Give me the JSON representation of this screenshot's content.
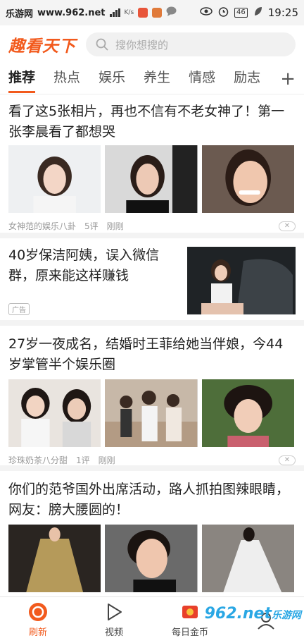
{
  "status_bar": {
    "site": "乐游网",
    "site_url": "www.962.net",
    "speed_unit": "K/s",
    "battery": "46",
    "time": "19:25"
  },
  "header": {
    "logo": "趣看天下",
    "search_placeholder": "搜你想搜的"
  },
  "tabs": [
    {
      "label": "推荐",
      "active": true
    },
    {
      "label": "热点"
    },
    {
      "label": "娱乐"
    },
    {
      "label": "养生"
    },
    {
      "label": "情感"
    },
    {
      "label": "励志"
    }
  ],
  "tab_add": "+",
  "articles": [
    {
      "title": "看了这5张相片，再也不信有不老女神了！第一张李晨看了都想哭",
      "source": "女神范的娱乐八卦",
      "comments": "5评",
      "time": "刚刚"
    },
    {
      "title": "40岁保洁阿姨，误入微信群，原来能这样赚钱",
      "badge": "广告"
    },
    {
      "title": "27岁一夜成名，结婚时王菲给她当伴娘，今44岁掌管半个娱乐圈",
      "source": "珍珠奶茶八分甜",
      "comments": "1评",
      "time": "刚刚"
    },
    {
      "title": "你们的范爷国外出席活动，路人抓拍图辣眼睛，网友：膀大腰圆的！"
    }
  ],
  "bottom_nav": [
    {
      "label": "刷新",
      "icon": "refresh-icon",
      "active": true
    },
    {
      "label": "视频",
      "icon": "play-icon"
    },
    {
      "label": "每日金币",
      "icon": "coin-icon"
    }
  ],
  "watermark": "962.net",
  "watermark_sub": "乐游网",
  "colors": {
    "accent": "#f25a1d",
    "divider": "#f3f3f3"
  }
}
